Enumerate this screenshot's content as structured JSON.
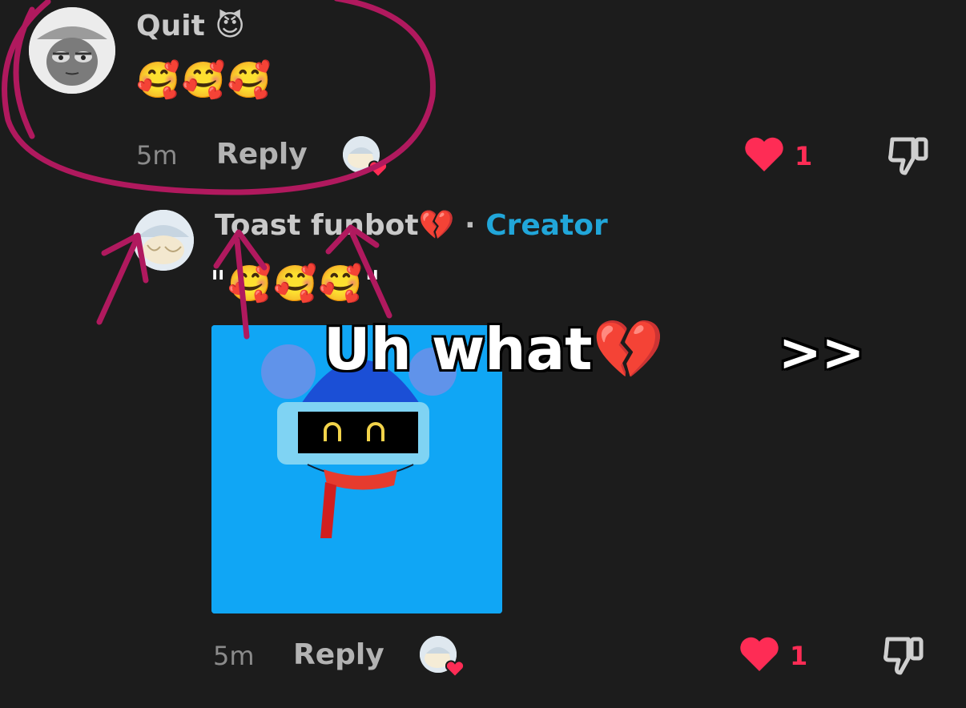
{
  "comment1": {
    "username": "Quit",
    "username_emoji": "😈",
    "text": "🥰🥰🥰",
    "time": "5m",
    "reply_label": "Reply",
    "like_count": "1"
  },
  "comment2": {
    "username": "Toast funbot",
    "username_emoji": "💔",
    "separator": "·",
    "badge": "Creator",
    "text": "\"🥰🥰🥰\"",
    "time": "5m",
    "reply_label": "Reply",
    "like_count": "1"
  },
  "overlay": {
    "caption": "Uh what",
    "caption_emoji": "💔",
    "arrows": ">>"
  },
  "colors": {
    "background": "#1c1c1c",
    "like_red": "#fe2c55",
    "creator_blue": "#21a6d9",
    "annotation_magenta": "#b0195e",
    "image_bg": "#10a6f5"
  },
  "icons": {
    "like": "heart-icon",
    "dislike": "thumbs-down-icon",
    "liked_by_creator": "creator-liked-icon"
  }
}
